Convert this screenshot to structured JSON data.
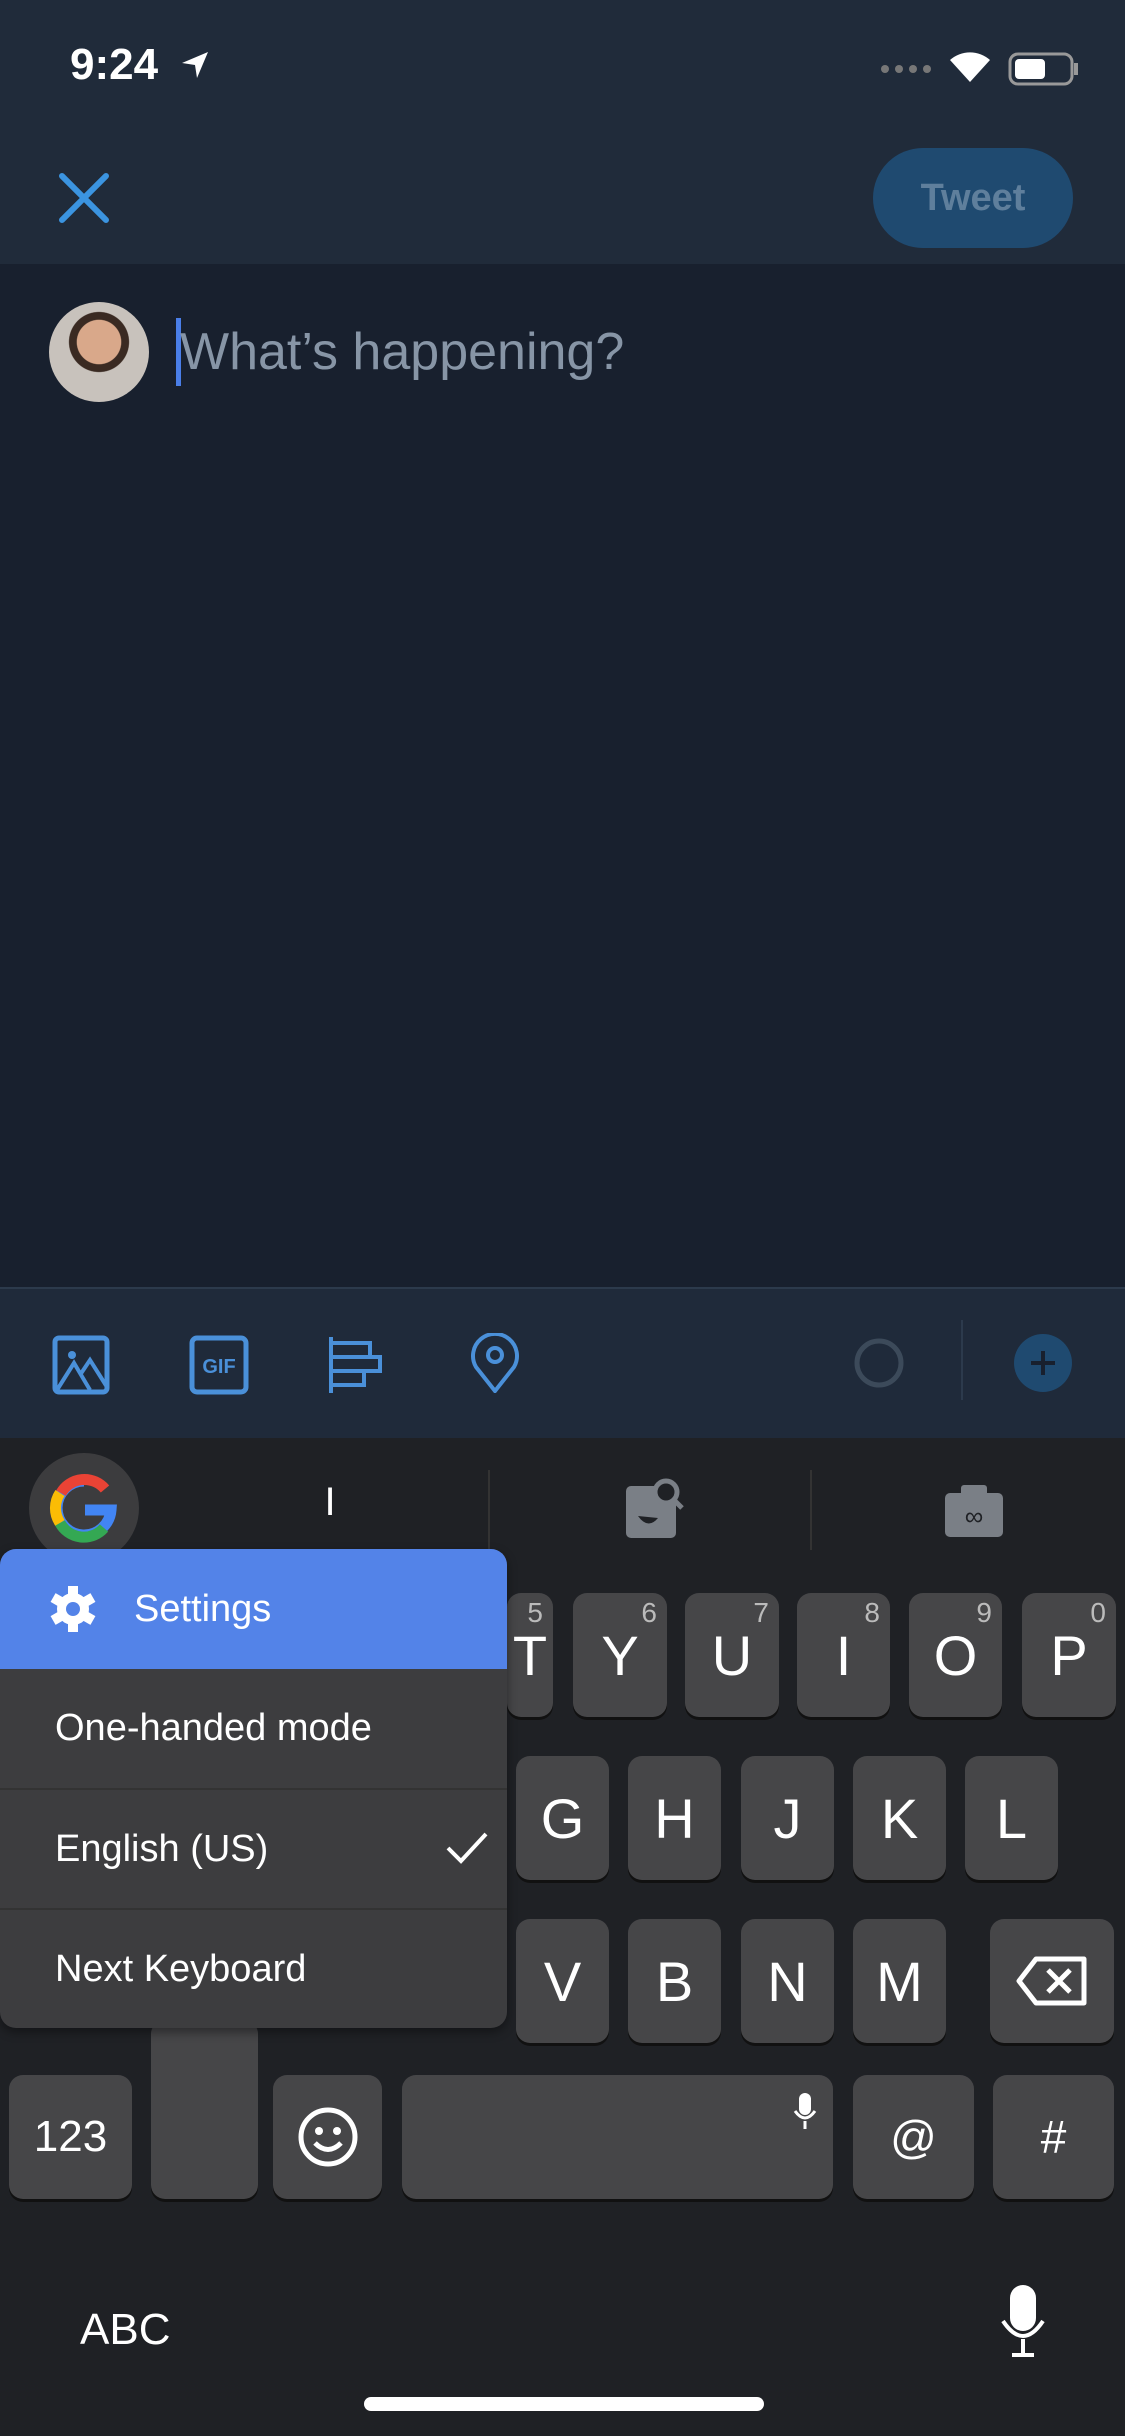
{
  "status_bar": {
    "time": "9:24"
  },
  "header": {
    "tweet_label": "Tweet",
    "accent": "#1da1f2"
  },
  "compose": {
    "placeholder": "What’s happening?"
  },
  "toolbar": {
    "icons": [
      "image-icon",
      "gif-icon",
      "poll-icon",
      "location-icon"
    ],
    "gif_label": "GIF"
  },
  "keyboard": {
    "suggestion": "I",
    "row1": [
      {
        "k": "T",
        "d": "5"
      },
      {
        "k": "Y",
        "d": "6"
      },
      {
        "k": "U",
        "d": "7"
      },
      {
        "k": "I",
        "d": "8"
      },
      {
        "k": "O",
        "d": "9"
      },
      {
        "k": "P",
        "d": "0"
      }
    ],
    "row2": [
      "G",
      "H",
      "J",
      "K",
      "L"
    ],
    "row3": [
      "V",
      "B",
      "N",
      "M"
    ],
    "numbers_label": "123",
    "at_label": "@",
    "hash_label": "#",
    "abc_label": "ABC"
  },
  "menu": {
    "settings": "Settings",
    "items": [
      "One-handed mode",
      "English (US)",
      "Next Keyboard"
    ],
    "settings_color": "#5383e8"
  }
}
